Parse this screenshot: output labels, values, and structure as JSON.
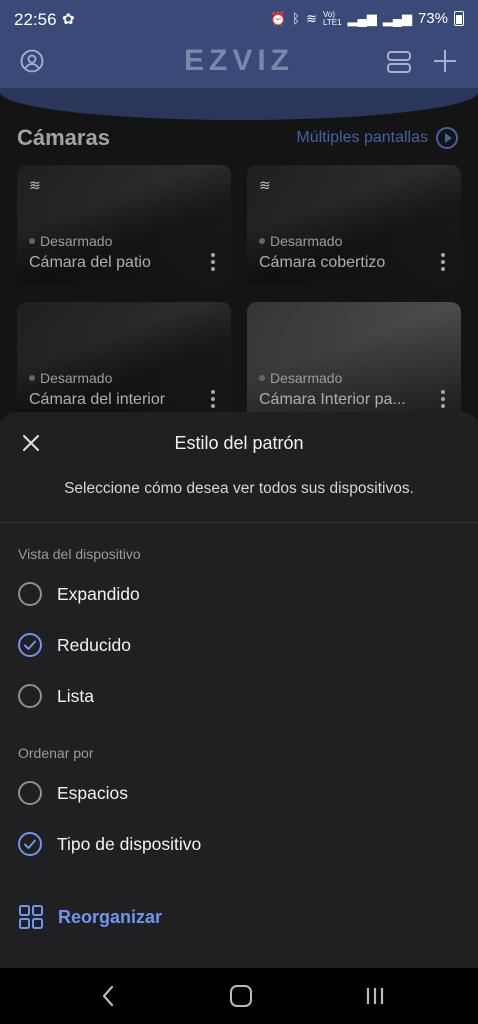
{
  "status_bar": {
    "time": "22:56",
    "battery": "73%",
    "icons": [
      "leaf-icon",
      "alarm-icon",
      "bluetooth-icon",
      "wifi-icon",
      "volte-icon",
      "signal-icon",
      "battery-icon"
    ]
  },
  "header": {
    "logo": "EZVIZ",
    "icons": [
      "profile-icon",
      "layout-icon",
      "plus-icon"
    ]
  },
  "cameras": {
    "title": "Cámaras",
    "multi_screen_label": "Múltiples pantallas",
    "items": [
      {
        "status": "Desarmado",
        "name": "Cámara del patio"
      },
      {
        "status": "Desarmado",
        "name": "Cámara cobertizo"
      },
      {
        "status": "Desarmado",
        "name": "Cámara del interior"
      },
      {
        "status": "Desarmado",
        "name": "Cámara Interior pa..."
      }
    ]
  },
  "sheet": {
    "title": "Estilo del patrón",
    "subtitle": "Seleccione cómo desea ver todos sus dispositivos.",
    "device_view_label": "Vista del dispositivo",
    "device_view_options": [
      {
        "label": "Expandido",
        "checked": false
      },
      {
        "label": "Reducido",
        "checked": true
      },
      {
        "label": "Lista",
        "checked": false
      }
    ],
    "sort_label": "Ordenar por",
    "sort_options": [
      {
        "label": "Espacios",
        "checked": false
      },
      {
        "label": "Tipo de dispositivo",
        "checked": true
      }
    ],
    "reorganize_label": "Reorganizar"
  },
  "colors": {
    "accent": "#6f95ee",
    "header": "#3a4a78",
    "sheet_bg": "#202023"
  }
}
